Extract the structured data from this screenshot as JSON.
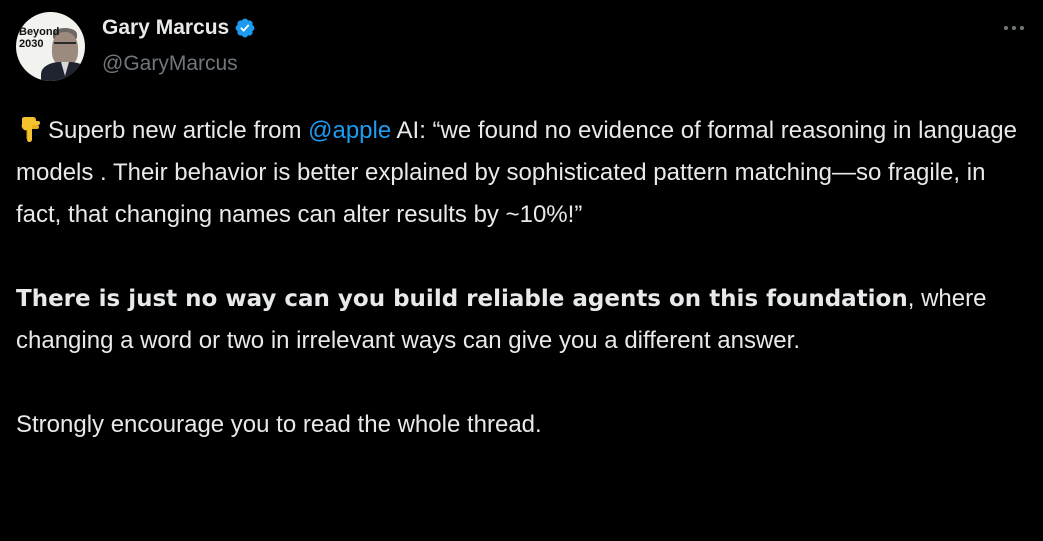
{
  "author": {
    "display_name": "Gary Marcus",
    "handle": "@GaryMarcus",
    "verified": true,
    "verified_color": "#1d9bf0",
    "avatar": {
      "text_line1": "Beyond",
      "text_line2": "2030"
    }
  },
  "menu": {
    "icon": "more-horizontal-icon"
  },
  "tweet": {
    "para1": {
      "emoji": "backhand-index-pointing-down-icon",
      "text_before_mention": "Superb new article from ",
      "mention": "@apple",
      "text_after_mention": " AI: “we found no evidence of formal reasoning in language models . Their behavior is better explained by sophisticated pattern matching—so fragile, in fact, that changing names can alter results by ~10%!”"
    },
    "para2": {
      "bold_text": "There is just no way can you build reliable agents on this foundation",
      "rest_text": ", where changing a word or two in irrelevant ways can give you a different answer."
    },
    "para3": {
      "text": "Strongly encourage you to read the whole thread."
    }
  },
  "colors": {
    "background": "#000000",
    "text": "#e7e9ea",
    "secondary": "#71767b",
    "link": "#1d9bf0"
  }
}
